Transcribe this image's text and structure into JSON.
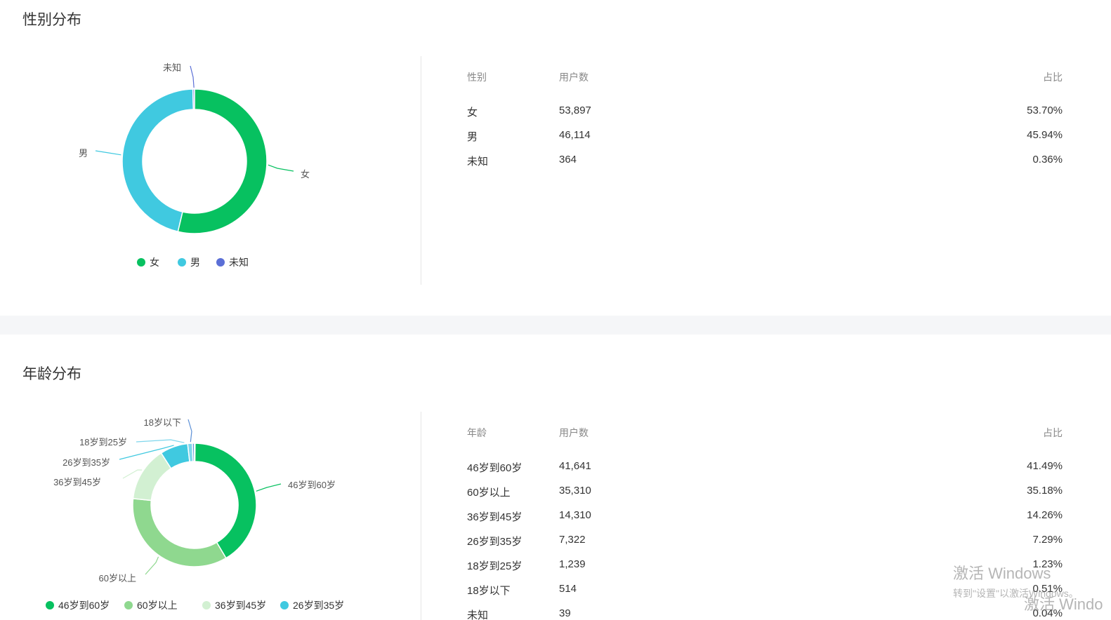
{
  "gender": {
    "title": "性别分布",
    "columns": [
      "性别",
      "用户数",
      "占比"
    ],
    "rows": [
      {
        "label": "女",
        "count": "53,897",
        "ratio": "53.70%"
      },
      {
        "label": "男",
        "count": "46,114",
        "ratio": "45.94%"
      },
      {
        "label": "未知",
        "count": "364",
        "ratio": "0.36%"
      }
    ],
    "legend": [
      "女",
      "男",
      "未知"
    ]
  },
  "age": {
    "title": "年龄分布",
    "columns": [
      "年龄",
      "用户数",
      "占比"
    ],
    "rows": [
      {
        "label": "46岁到60岁",
        "count": "41,641",
        "ratio": "41.49%"
      },
      {
        "label": "60岁以上",
        "count": "35,310",
        "ratio": "35.18%"
      },
      {
        "label": "36岁到45岁",
        "count": "14,310",
        "ratio": "14.26%"
      },
      {
        "label": "26岁到35岁",
        "count": "7,322",
        "ratio": "7.29%"
      },
      {
        "label": "18岁到25岁",
        "count": "1,239",
        "ratio": "1.23%"
      },
      {
        "label": "18岁以下",
        "count": "514",
        "ratio": "0.51%"
      },
      {
        "label": "未知",
        "count": "39",
        "ratio": "0.04%"
      }
    ],
    "legend": [
      "46岁到60岁",
      "60岁以上",
      "36岁到45岁",
      "26岁到35岁"
    ]
  },
  "watermark": {
    "line1": "激活 Windows",
    "line2": "转到\"设置\"以激活Windows。",
    "line3": "激活 Windo"
  },
  "colors": {
    "female": "#07c160",
    "male": "#40c9e0",
    "unknown": "#5b6fd6",
    "age_46_60": "#07c160",
    "age_60_plus": "#8fd88f",
    "age_36_45": "#d2f0d2",
    "age_26_35": "#40c9e0",
    "age_18_25": "#7fd6ec",
    "age_under_18": "#5b8fd6",
    "age_unknown": "#8a6fd6"
  },
  "chart_data": [
    {
      "type": "pie",
      "title": "性别分布",
      "categories": [
        "女",
        "男",
        "未知"
      ],
      "values": [
        53897,
        46114,
        364
      ],
      "legend": "bottom"
    },
    {
      "type": "pie",
      "title": "年龄分布",
      "categories": [
        "46岁到60岁",
        "60岁以上",
        "36岁到45岁",
        "26岁到35岁",
        "18岁到25岁",
        "18岁以下",
        "未知"
      ],
      "values": [
        41641,
        35310,
        14310,
        7322,
        1239,
        514,
        39
      ],
      "legend": "bottom"
    }
  ]
}
